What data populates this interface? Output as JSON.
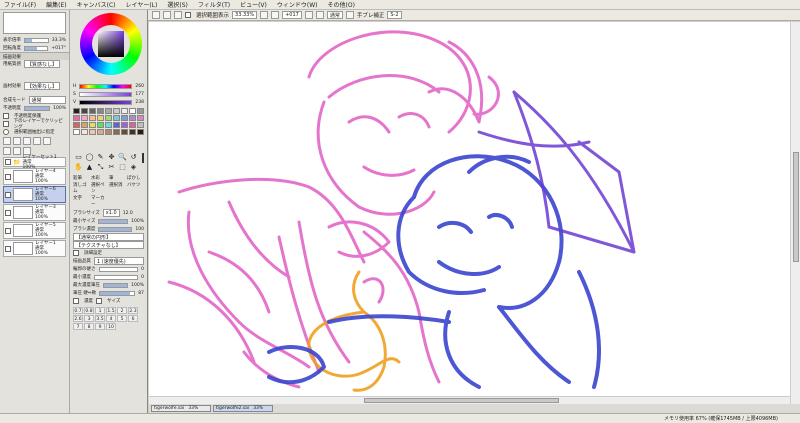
{
  "menu": [
    "ファイル(F)",
    "編集(E)",
    "キャンバス(C)",
    "レイヤー(L)",
    "選択(S)",
    "フィルタ(T)",
    "ビュー(V)",
    "ウィンドウ(W)",
    "その他(O)"
  ],
  "toolbar": {
    "selection_label": "選択範囲表示",
    "zoom": "33.33%",
    "angle": "+017",
    "blend": "通常",
    "stabilizer_label": "手ブレ補正",
    "stabilizer": "S-2"
  },
  "nav": {
    "zoom_label": "表示倍率",
    "zoom_value": "33.3%",
    "angle_label": "回転角度",
    "angle_value": "+017°"
  },
  "layer_effects": {
    "title": "描画効果",
    "paper_label": "用紙質感",
    "paper_value": "【質感なし】",
    "effect_label": "画材効果",
    "effect_value": "【効果なし】"
  },
  "composite": {
    "mode_label": "合成モード",
    "mode_value": "通常",
    "opacity_label": "不透明度",
    "opacity_value": "100%",
    "options": [
      "不透明度保護",
      "下のレイヤーでクリッピング",
      "選択範囲抽出に指定"
    ]
  },
  "layers": [
    {
      "name": "レイヤーセット1",
      "mode": "通常",
      "opacity": "100%",
      "folder": true,
      "selected": false
    },
    {
      "name": "レイヤー4",
      "mode": "通常",
      "opacity": "100%",
      "folder": false,
      "selected": false
    },
    {
      "name": "レイヤー6",
      "mode": "通常",
      "opacity": "100%",
      "folder": false,
      "selected": true
    },
    {
      "name": "レイヤー3",
      "mode": "通常",
      "opacity": "100%",
      "folder": false,
      "selected": false
    },
    {
      "name": "レイヤー5",
      "mode": "通常",
      "opacity": "100%",
      "folder": false,
      "selected": false
    },
    {
      "name": "レイヤー1",
      "mode": "通常",
      "opacity": "100%",
      "folder": false,
      "selected": false
    }
  ],
  "color": {
    "h_label": "H",
    "h_value": "260",
    "s_label": "S",
    "s_value": "177",
    "v_label": "V",
    "v_value": "238",
    "main": "#7b3fe0"
  },
  "swatches": [
    "#222222",
    "#444444",
    "#666666",
    "#888888",
    "#aaaaaa",
    "#cccccc",
    "#eeeeee",
    "#ffffff",
    "#999999",
    "#e86aa0",
    "#f2a7c4",
    "#f5c08a",
    "#e9d27a",
    "#a7d67a",
    "#7ac9d6",
    "#7a9ed6",
    "#a88ad6",
    "#d68ac4",
    "#e06060",
    "#e0a060",
    "#e0e060",
    "#60e060",
    "#60e0e0",
    "#6060e0",
    "#a060e0",
    "#e060a0",
    "#c0c0c0",
    "#ffffff",
    "#f4e3d7",
    "#e8c8b0",
    "#d8a890",
    "#b8886a",
    "#8a6a4a",
    "#6a4a30",
    "#4a3020",
    "#2a1a10"
  ],
  "tools": {
    "row1": [
      "▭",
      "◯",
      "✎",
      "✥",
      "🔍",
      "↺"
    ],
    "row2": [
      "✋",
      "▲",
      "⤡",
      "✂",
      "⬚",
      "◈"
    ],
    "brush_labels": [
      "鉛筆",
      "水彩",
      "筆",
      "ぼかし",
      "消しゴム",
      "選択ペン",
      "選択消",
      "バケツ",
      "文字",
      "マーカー"
    ]
  },
  "brush": {
    "size_label": "ブラシサイズ",
    "size_mult": "x1.0",
    "size_value": "12.0",
    "min_label": "最小サイズ",
    "min_value": "100%",
    "density_label": "ブラシ濃度",
    "density_value": "100",
    "shape_label": "【通常の円形】",
    "texture_label": "【テクスチャなし】",
    "detail_label": "詳細設定",
    "quality_label": "描画品質",
    "quality_value": "1 (速度優先)",
    "edge_label": "輪郭の硬さ",
    "edge_value": "0",
    "min_density_label": "最小濃度",
    "min_density_value": "0",
    "max_pressure_label": "最大濃度筆圧",
    "max_pressure_value": "100%",
    "pressure_label": "筆圧 硬⇔軟",
    "pressure_value": "87",
    "pressure_opts": [
      "濃度",
      "サイズ"
    ]
  },
  "size_presets": [
    "0.7",
    "0.8",
    "1",
    "1.5",
    "2",
    "2.3",
    "2.6",
    "3",
    "3.5",
    "4",
    "5",
    "6",
    "7",
    "8",
    "9",
    "10"
  ],
  "file_tabs": [
    {
      "name": "tigerwolfe.sai",
      "zoom": "33%",
      "active": false
    },
    {
      "name": "tigerwolfe2.sai",
      "zoom": "33%",
      "active": true
    }
  ],
  "status": "メモリ使用率 67% (確保1745MB / 上限4096MB)"
}
